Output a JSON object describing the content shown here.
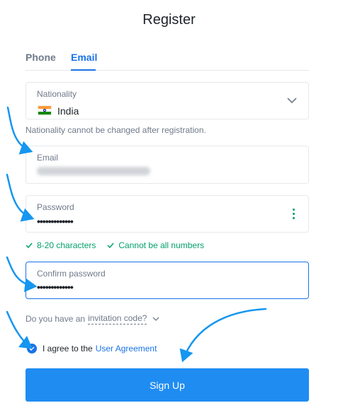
{
  "page": {
    "title": "Register"
  },
  "tabs": [
    {
      "label": "Phone",
      "active": false
    },
    {
      "label": "Email",
      "active": true
    }
  ],
  "nationality": {
    "label": "Nationality",
    "value": "India",
    "flag": "india-flag",
    "helper": "Nationality cannot be changed after registration."
  },
  "email": {
    "label": "Email",
    "value": "(blurred)"
  },
  "password": {
    "label": "Password",
    "value": "•••••••••••••",
    "menu_icon": "more-vertical-icon"
  },
  "password_checks": [
    {
      "text": "8-20 characters",
      "ok": true
    },
    {
      "text": "Cannot be all numbers",
      "ok": true
    }
  ],
  "confirm_password": {
    "label": "Confirm password",
    "value": "•••••••••••••"
  },
  "invitation": {
    "prefix": "Do you have an",
    "link": "invitation code?"
  },
  "agreement": {
    "checked": true,
    "text": "I agree to the",
    "link": "User Agreement"
  },
  "signup_button": {
    "label": "Sign Up"
  },
  "colors": {
    "primary": "#1a73e8",
    "button": "#1f8cf2",
    "success": "#02a06a",
    "annotation_arrow": "#1596f0"
  }
}
